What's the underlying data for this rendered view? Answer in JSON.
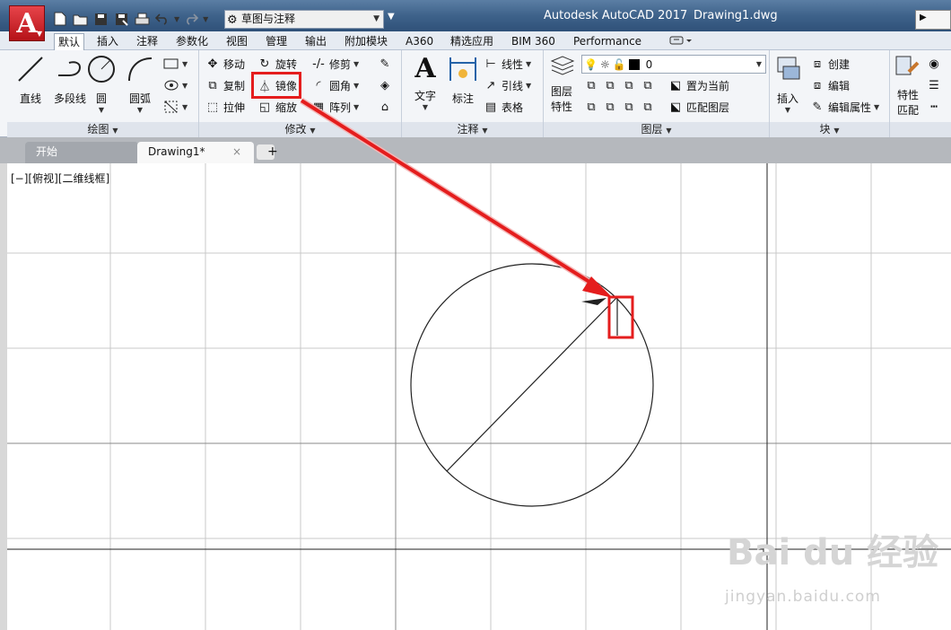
{
  "app": {
    "title": "Autodesk AutoCAD 2017",
    "file": "Drawing1.dwg",
    "logo_letter": "A"
  },
  "workspace": {
    "value": "草图与注释"
  },
  "ribbon_tabs": [
    "默认",
    "插入",
    "注释",
    "参数化",
    "视图",
    "管理",
    "输出",
    "附加模块",
    "A360",
    "精选应用",
    "BIM 360",
    "Performance"
  ],
  "draw": {
    "title": "绘图",
    "line": "直线",
    "polyline": "多段线",
    "circle": "圆",
    "arc": "圆弧"
  },
  "modify": {
    "title": "修改",
    "move": "移动",
    "rotate": "旋转",
    "trim": "修剪",
    "copy": "复制",
    "mirror": "镜像",
    "fillet": "圆角",
    "stretch": "拉伸",
    "scale": "缩放",
    "array": "阵列"
  },
  "annotation": {
    "title": "注释",
    "text": "文字",
    "dimension": "标注",
    "linetype": "线性",
    "leader": "引线",
    "table": "表格"
  },
  "layers": {
    "title": "图层",
    "properties_line1": "图层",
    "properties_line2": "特性",
    "current_layer": "0",
    "set_current": "置为当前",
    "match_layer": "匹配图层"
  },
  "block": {
    "title": "块",
    "insert": "插入",
    "create": "创建",
    "edit": "编辑",
    "edit_attributes": "编辑属性"
  },
  "properties": {
    "line1": "特性",
    "line2": "匹配"
  },
  "file_tabs": {
    "start": "开始",
    "drawing": "Drawing1*"
  },
  "viewport_label": "[−][俯视][二维线框]",
  "watermark": {
    "main": "Bai du 经验",
    "sub": "jingyan.baidu.com"
  },
  "colors": {
    "accent_red": "#e41d1d",
    "title_bar": "#3e628a"
  }
}
